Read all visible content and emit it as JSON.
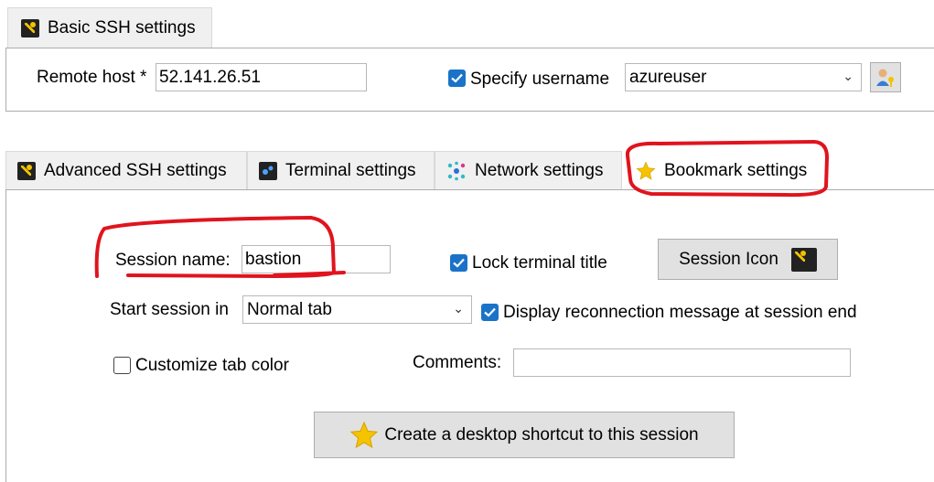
{
  "basic_tab": {
    "label": "Basic SSH settings"
  },
  "basic": {
    "remote_host_label": "Remote host *",
    "remote_host_value": "52.141.26.51",
    "specify_username_label": "Specify username",
    "specify_username_checked": true,
    "username_value": "azureuser"
  },
  "tabs": [
    {
      "label": "Advanced SSH settings",
      "icon": "wrench-icon"
    },
    {
      "label": "Terminal settings",
      "icon": "terminal-icon"
    },
    {
      "label": "Network settings",
      "icon": "network-icon"
    },
    {
      "label": "Bookmark settings",
      "icon": "star-icon",
      "active": true
    }
  ],
  "bookmark": {
    "session_name_label": "Session name:",
    "session_name_value": "bastion",
    "lock_title_label": "Lock terminal title",
    "lock_title_checked": true,
    "session_icon_label": "Session Icon",
    "start_session_label": "Start session in",
    "start_session_value": "Normal tab",
    "display_reconnect_label": "Display reconnection message at session end",
    "display_reconnect_checked": true,
    "customize_color_label": "Customize tab color",
    "customize_color_checked": false,
    "comments_label": "Comments:",
    "comments_value": "",
    "shortcut_label": "Create a desktop shortcut to this session"
  },
  "colors": {
    "annotation": "#e0141e",
    "checkbox": "#1a73c8",
    "star": "#f5c400"
  }
}
